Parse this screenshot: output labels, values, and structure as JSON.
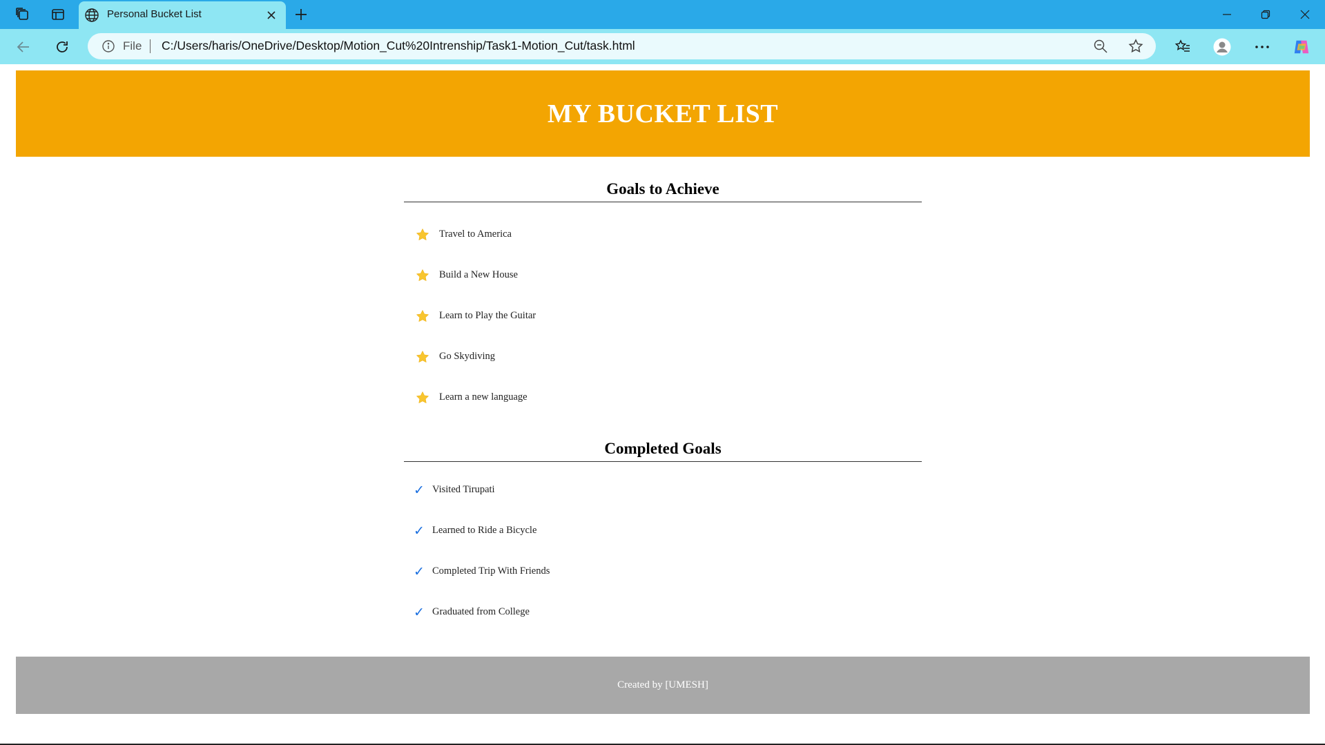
{
  "browser": {
    "tab_title": "Personal Bucket List",
    "address_scheme": "File",
    "url": "C:/Users/haris/OneDrive/Desktop/Motion_Cut%20Intrenship/Task1-Motion_Cut/task.html"
  },
  "page": {
    "header_title": "MY BUCKET LIST",
    "goals": {
      "heading": "Goals to Achieve",
      "items": [
        "Travel to America",
        "Build a New House",
        "Learn to Play the Guitar",
        "Go Skydiving",
        "Learn a new language"
      ]
    },
    "completed": {
      "heading": "Completed Goals",
      "check_symbol": "✓",
      "items": [
        "Visited Tirupati",
        "Learned to Ride a Bicycle",
        "Completed Trip With Friends",
        "Graduated from College"
      ]
    },
    "footer_text": "Created by [UMESH]"
  },
  "colors": {
    "header_bg": "#f3a502",
    "footer_bg": "#a8a8a8",
    "star": "#f8c52f",
    "check": "#1a6fe0",
    "tabbar": "#2aa9e8",
    "toolbar": "#8ee6f3"
  }
}
